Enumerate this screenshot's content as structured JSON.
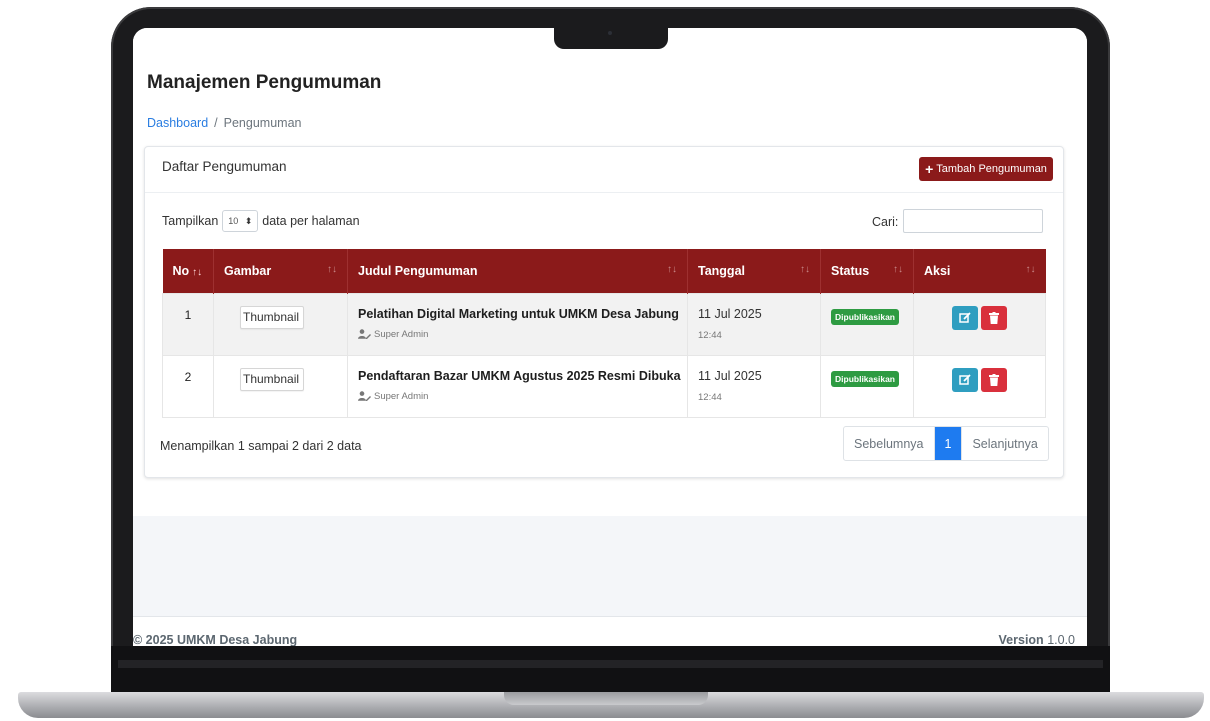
{
  "page": {
    "title": "Manajemen Pengumuman",
    "breadcrumb": {
      "home": "Dashboard",
      "separator": "/",
      "current": "Pengumuman"
    }
  },
  "card": {
    "title": "Daftar Pengumuman",
    "add_button": "Tambah Pengumuman",
    "add_icon": "plus-icon"
  },
  "controls": {
    "show_label": "Tampilkan",
    "page_length": "10",
    "per_page_label": "data per halaman",
    "search_label": "Cari:",
    "search_value": ""
  },
  "table": {
    "columns": [
      "No",
      "Gambar",
      "Judul Pengumuman",
      "Tanggal",
      "Status",
      "Aksi"
    ],
    "sorted_column": "No",
    "rows": [
      {
        "no": "1",
        "image_alt": "Thumbnail",
        "title": "Pelatihan Digital Marketing untuk UMKM Desa Jabung",
        "author": "Super Admin",
        "date": "11 Jul 2025",
        "time": "12:44",
        "status": "Dipublikasikan"
      },
      {
        "no": "2",
        "image_alt": "Thumbnail",
        "title": "Pendaftaran Bazar UMKM Agustus 2025 Resmi Dibuka",
        "author": "Super Admin",
        "date": "11 Jul 2025",
        "time": "12:44",
        "status": "Dipublikasikan"
      }
    ]
  },
  "info": "Menampilkan 1 sampai 2 dari 2 data",
  "pagination": {
    "prev": "Sebelumnya",
    "current": "1",
    "next": "Selanjutnya"
  },
  "footer": {
    "copyright": "© 2025 UMKM Desa Jabung",
    "version_label": "Version",
    "version_value": "1.0.0"
  },
  "colors": {
    "brand": "#8b1a1a",
    "status_published": "#2e9b42",
    "edit_button": "#2f9ec0",
    "delete_button": "#d9303c",
    "active_page": "#1e7bf0",
    "link": "#2a7de1"
  }
}
